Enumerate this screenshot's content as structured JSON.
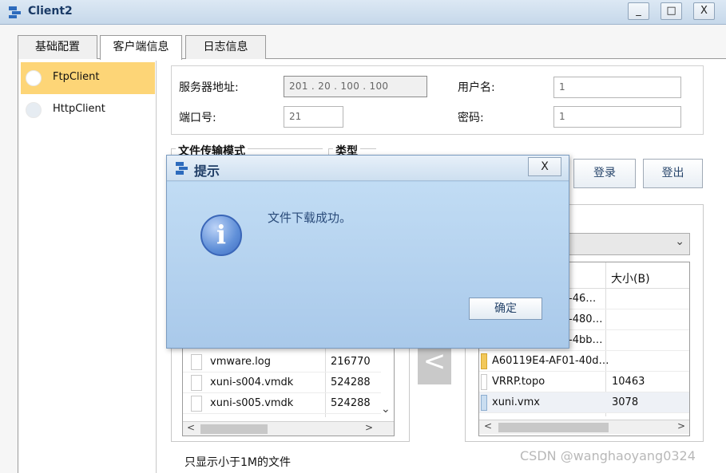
{
  "window": {
    "title": "Client2",
    "minimize": "_",
    "maximize": "□",
    "close": "X"
  },
  "tabs": [
    {
      "label": "基础配置"
    },
    {
      "label": "客户端信息"
    },
    {
      "label": "日志信息"
    }
  ],
  "sidebar": {
    "items": [
      {
        "label": "FtpClient"
      },
      {
        "label": "HttpClient"
      }
    ]
  },
  "form": {
    "server_label": "服务器地址:",
    "server_value": "201 . 20 . 100 . 100",
    "username_label": "用户名:",
    "username_value": "1",
    "port_label": "端口号:",
    "port_value": "21",
    "password_label": "密码:",
    "password_value": "1"
  },
  "groups": {
    "transfer_mode": "文件传输模式",
    "type": "类型"
  },
  "buttons": {
    "login": "登录",
    "logout": "登出",
    "transfer_arrow": "<"
  },
  "local_files": {
    "rows": [
      {
        "name": "vmware.log",
        "size": "216770"
      },
      {
        "name": "xuni-s004.vmdk",
        "size": "524288"
      },
      {
        "name": "xuni-s005.vmdk",
        "size": "524288"
      }
    ],
    "scroll_down": "⌄",
    "scroll_left": "<",
    "scroll_right": ">"
  },
  "remote_files": {
    "dropdown_arrow": "⌄",
    "size_header": "大小(B)",
    "rows": [
      {
        "name": "-46…",
        "size": ""
      },
      {
        "name": "-480…",
        "size": ""
      },
      {
        "name": "-4bb…",
        "size": ""
      },
      {
        "name": "A60119E4-AF01-40d…",
        "size": ""
      },
      {
        "name": "VRRP.topo",
        "size": "10463"
      },
      {
        "name": "xuni.vmx",
        "size": "3078"
      }
    ],
    "scroll_left": "<",
    "scroll_right": ">"
  },
  "footer": {
    "filter_text": "只显示小于1M的文件",
    "watermark": "CSDN @wanghaoyang0324"
  },
  "dialog": {
    "title": "提示",
    "close": "X",
    "message": "文件下载成功。",
    "info_glyph": "i",
    "ok": "确定"
  }
}
